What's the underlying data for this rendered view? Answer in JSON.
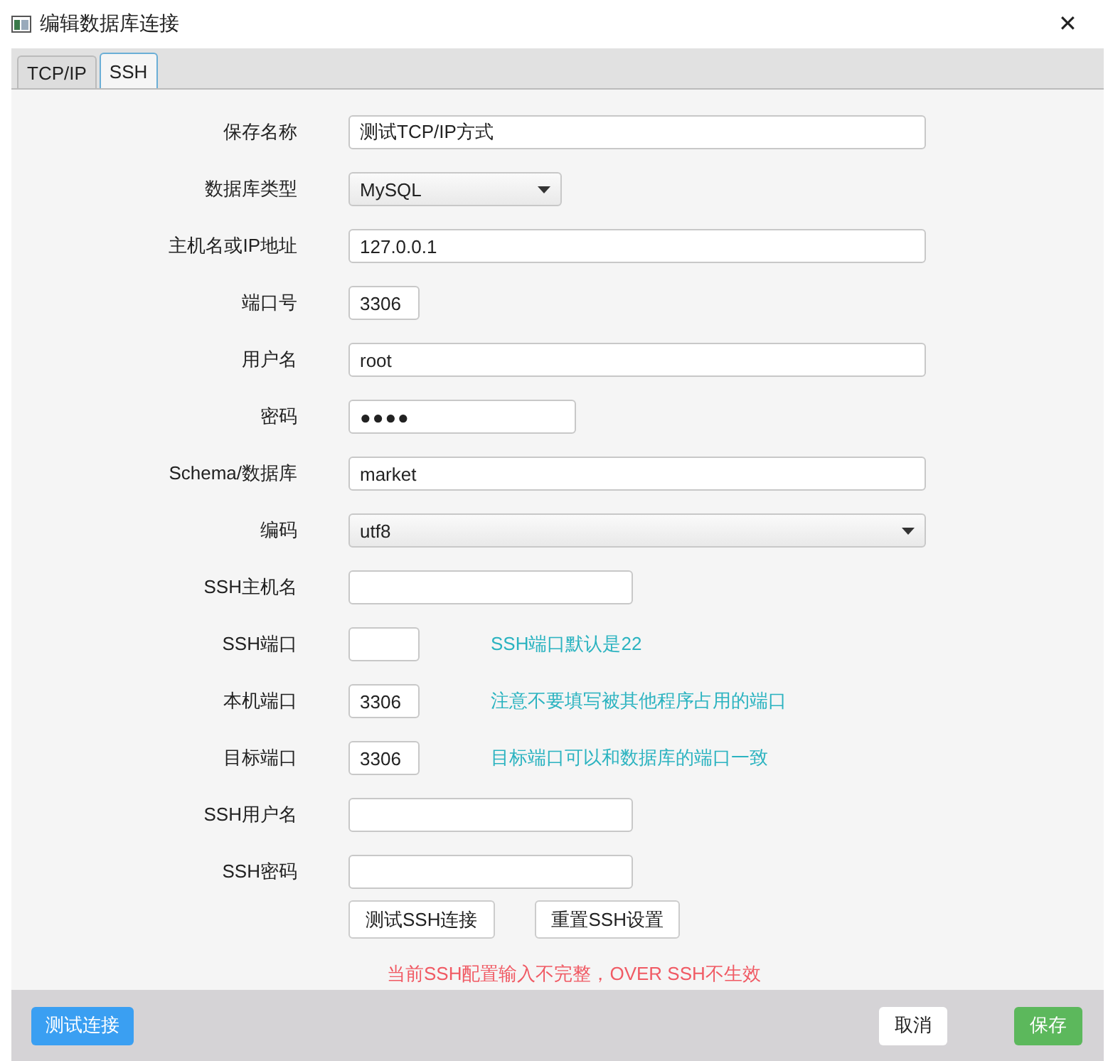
{
  "window": {
    "title": "编辑数据库连接",
    "close": "✕"
  },
  "tabs": [
    {
      "label": "TCP/IP",
      "selected": false
    },
    {
      "label": "SSH",
      "selected": true
    }
  ],
  "form": {
    "rows": [
      {
        "label": "保存名称",
        "kind": "text",
        "value": "测试TCP/IP方式"
      },
      {
        "label": "数据库类型",
        "kind": "select",
        "value": "MySQL"
      },
      {
        "label": "主机名或IP地址",
        "kind": "text",
        "value": "127.0.0.1"
      },
      {
        "label": "端口号",
        "kind": "text",
        "value": "3306"
      },
      {
        "label": "用户名",
        "kind": "text",
        "value": "root"
      },
      {
        "label": "密码",
        "kind": "password",
        "value": "●●●●"
      },
      {
        "label": "Schema/数据库",
        "kind": "text",
        "value": "market"
      },
      {
        "label": "编码",
        "kind": "select",
        "value": "utf8"
      },
      {
        "label": "SSH主机名",
        "kind": "text"
      },
      {
        "label": "SSH端口",
        "kind": "text",
        "hint": "SSH端口默认是22"
      },
      {
        "label": "本机端口",
        "kind": "text",
        "value": "3306",
        "hint": "注意不要填写被其他程序占用的端口"
      },
      {
        "label": "目标端口",
        "kind": "text",
        "value": "3306",
        "hint": "目标端口可以和数据库的端口一致"
      },
      {
        "label": "SSH用户名",
        "kind": "text"
      },
      {
        "label": "SSH密码",
        "kind": "text"
      }
    ],
    "buttons": [
      "测试SSH连接",
      "重置SSH设置"
    ],
    "error": "当前SSH配置输入不完整，OVER SSH不生效"
  },
  "footer": {
    "test_button": "测试连接",
    "cancel_button": "取消",
    "save_button": "保存"
  }
}
